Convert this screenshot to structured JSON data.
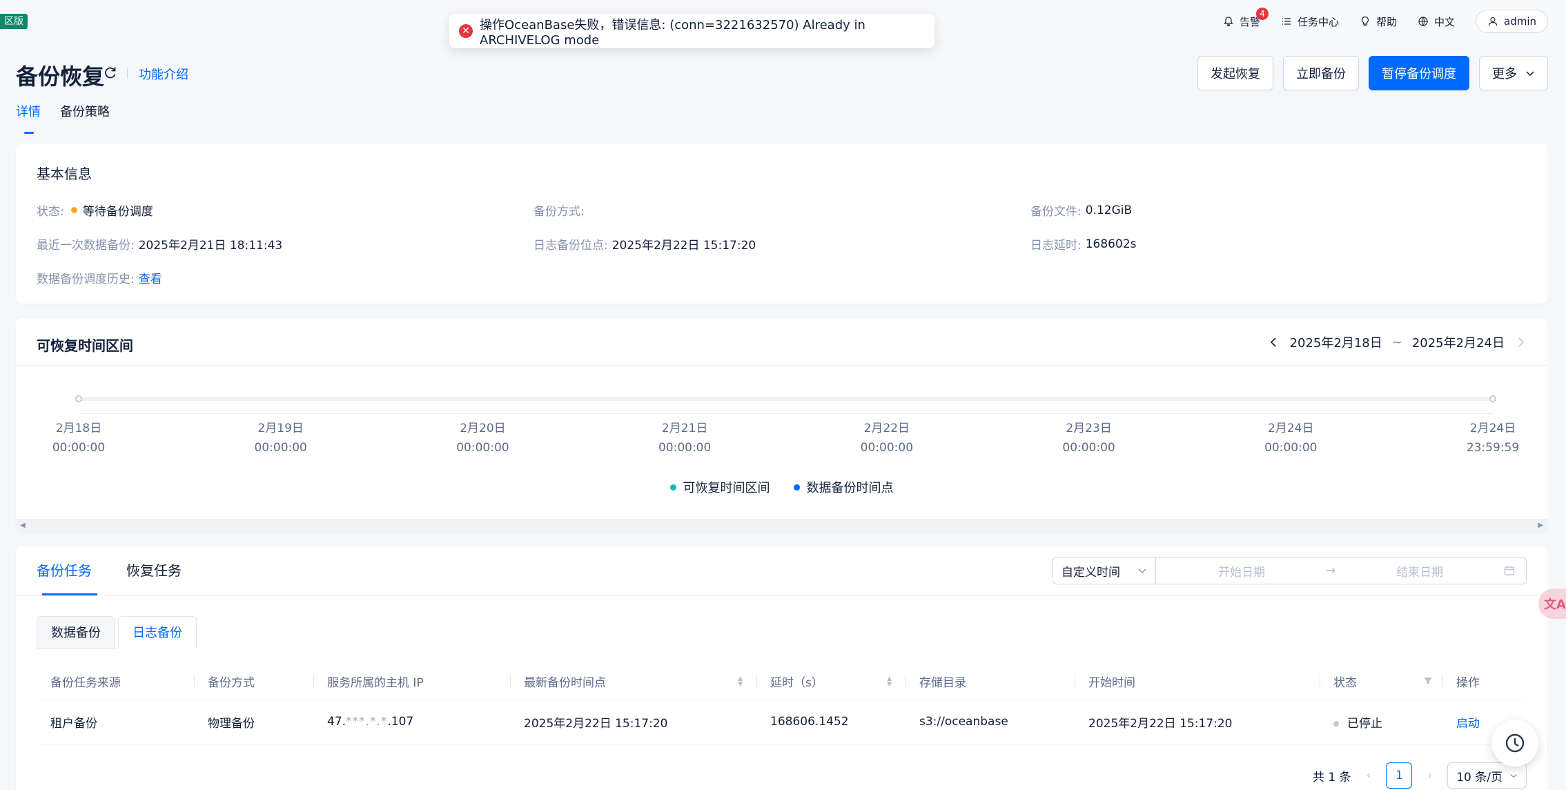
{
  "topbar": {
    "edition_badge": "区版",
    "alert_label": "告警",
    "alert_count": "4",
    "task_center_label": "任务中心",
    "help_label": "帮助",
    "language_label": "中文",
    "user_label": "admin"
  },
  "toast": {
    "message": "操作OceanBase失败，错误信息: (conn=3221632570) Already in ARCHIVELOG mode",
    "icon": "error-icon"
  },
  "header": {
    "title": "备份恢复",
    "feature_link": "功能介绍",
    "buttons": {
      "restore": "发起恢复",
      "backup_now": "立即备份",
      "pause_schedule": "暂停备份调度",
      "more": "更多"
    },
    "tabs": [
      "详情",
      "备份策略"
    ]
  },
  "basic_info": {
    "title": "基本信息",
    "status_label": "状态:",
    "status_value": "等待备份调度",
    "backup_method_label": "备份方式:",
    "backup_method_value": "",
    "backup_file_label": "备份文件:",
    "backup_file_value": "0.12GiB",
    "last_data_backup_label": "最近一次数据备份:",
    "last_data_backup_value": "2025年2月21日 18:11:43",
    "log_backup_point_label": "日志备份位点:",
    "log_backup_point_value": "2025年2月22日 15:17:20",
    "log_delay_label": "日志延时:",
    "log_delay_value": "168602s",
    "schedule_history_label": "数据备份调度历史:",
    "schedule_history_link": "查看"
  },
  "recoverable_range": {
    "title": "可恢复时间区间",
    "start_date": "2025年2月18日",
    "separator": "~",
    "end_date": "2025年2月24日",
    "ticks": [
      {
        "date": "2月18日",
        "time": "00:00:00"
      },
      {
        "date": "2月19日",
        "time": "00:00:00"
      },
      {
        "date": "2月20日",
        "time": "00:00:00"
      },
      {
        "date": "2月21日",
        "time": "00:00:00"
      },
      {
        "date": "2月22日",
        "time": "00:00:00"
      },
      {
        "date": "2月23日",
        "time": "00:00:00"
      },
      {
        "date": "2月24日",
        "time": "00:00:00"
      },
      {
        "date": "2月24日",
        "time": "23:59:59"
      }
    ],
    "legend": {
      "recoverable": "可恢复时间区间",
      "recoverable_color": "#19b4bd",
      "data_backup_point": "数据备份时间点",
      "data_backup_color": "#006aff"
    }
  },
  "tasks": {
    "tabs": [
      "备份任务",
      "恢复任务"
    ],
    "time_filter": "自定义时间",
    "start_placeholder": "开始日期",
    "range_arrow": "→",
    "end_placeholder": "结束日期",
    "sub_tabs": [
      "数据备份",
      "日志备份"
    ],
    "columns": [
      "备份任务来源",
      "备份方式",
      "服务所属的主机 IP",
      "最新备份时间点",
      "延时（s）",
      "存储目录",
      "开始时间",
      "状态",
      "操作"
    ],
    "rows": [
      {
        "source": "租户备份",
        "method": "物理备份",
        "ip_prefix": "47.",
        "ip_masked": "***.*.*",
        "ip_suffix": ".107",
        "latest_point": "2025年2月22日 15:17:20",
        "delay": "168606.1452",
        "storage": "s3://oceanbase",
        "start_time": "2025年2月22日 15:17:20",
        "status": "已停止",
        "action": "启动"
      }
    ],
    "pagination": {
      "total": "共 1 条",
      "current_page": "1",
      "page_size": "10 条/页"
    }
  },
  "colors": {
    "primary": "#006aff",
    "error": "#e5373f",
    "warning": "#ffa21d"
  }
}
